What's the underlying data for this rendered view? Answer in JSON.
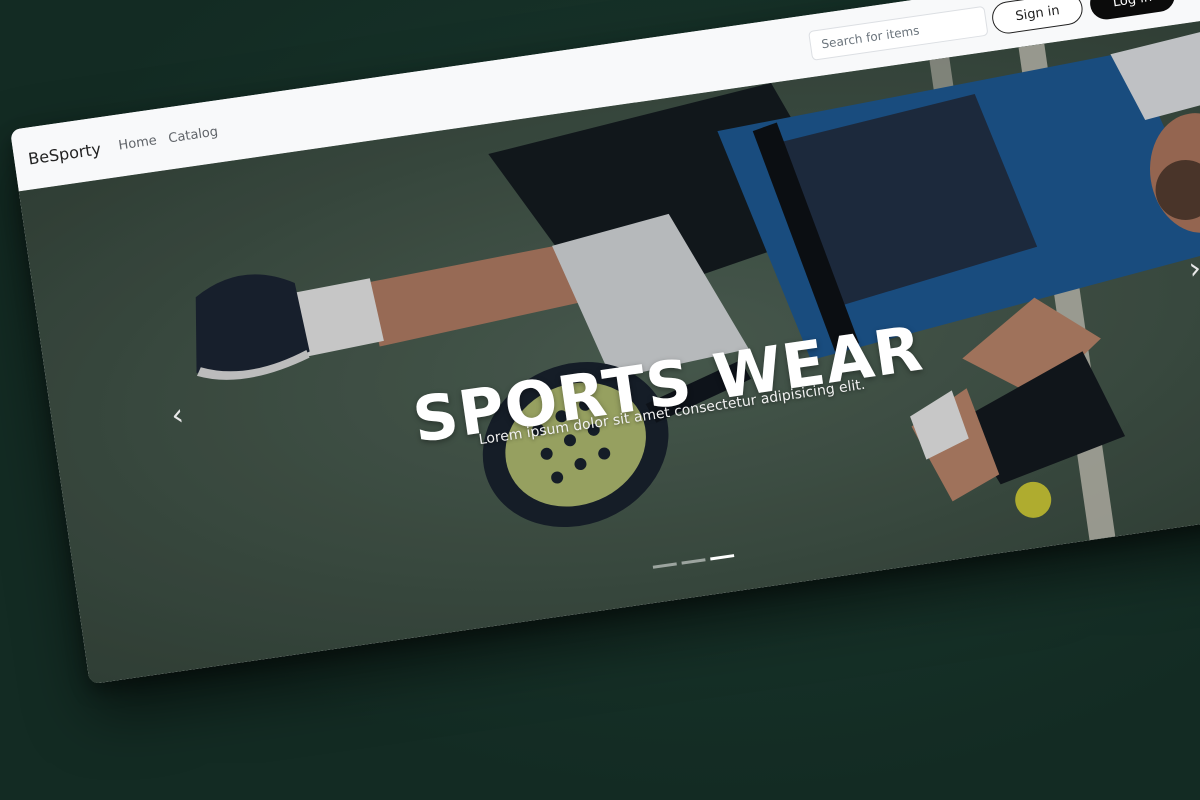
{
  "navbar": {
    "brand": "BeSporty",
    "links": [
      {
        "label": "Home"
      },
      {
        "label": "Catalog"
      }
    ],
    "search_placeholder": "Search for items",
    "signin_label": "Sign in",
    "login_label": "Log in"
  },
  "hero": {
    "title": "SPORTS WEAR",
    "subtitle": "Lorem ipsum dolor sit amet consectetur adipisicing elit.",
    "prev_icon": "chevron-left-icon",
    "next_icon": "chevron-right-icon",
    "slides_count": 3,
    "active_slide": 3
  },
  "colors": {
    "page_bg": "#132b23",
    "navbar_bg": "#f8f9fa",
    "button_dark": "#0b0b0b",
    "court_green": "#4a5e52",
    "shirt_blue": "#1f5d9a"
  }
}
